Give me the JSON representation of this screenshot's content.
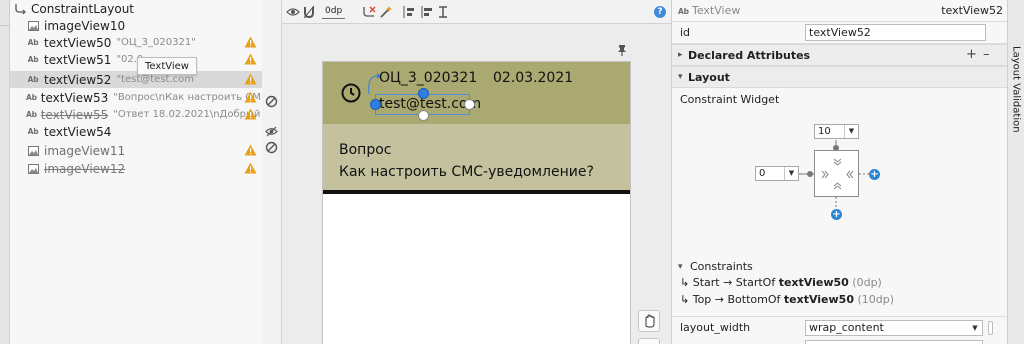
{
  "component_tree": {
    "root": {
      "label": "ConstraintLayout",
      "icon": "constraint-layout-icon"
    },
    "items": [
      {
        "name": "imageView10",
        "attr": "",
        "type": "image",
        "warning": false,
        "strike": false
      },
      {
        "name": "textView50",
        "attr": "\"ОЦ_3_020321\"",
        "type": "text",
        "warning": true,
        "strike": false
      },
      {
        "name": "textView51",
        "attr": "\"02.0",
        "type": "text",
        "warning": true,
        "strike": false
      },
      {
        "name": "textView52",
        "attr": "\"test@test.com",
        "type": "text",
        "warning": true,
        "strike": false,
        "selected": true
      },
      {
        "name": "textView53",
        "attr": "\"Вопрос\\nКак настроить СМ...",
        "type": "text",
        "warning": true,
        "strike": false
      },
      {
        "name": "textView55",
        "attr": "\"Ответ 18.02.2021\\nДобрый ...",
        "type": "text",
        "warning": true,
        "strike": true
      },
      {
        "name": "textView54",
        "attr": "",
        "type": "text",
        "warning": false,
        "strike": false
      },
      {
        "name": "imageView11",
        "attr": "",
        "type": "image",
        "warning": true,
        "strike": false
      },
      {
        "name": "imageView12",
        "attr": "",
        "type": "image",
        "warning": true,
        "strike": true
      }
    ],
    "tooltip": "TextView"
  },
  "canvas_toolbar": {
    "dp_value": "0dp",
    "icons": [
      "eye-icon",
      "magnet-icon",
      "clear-constraints-icon",
      "magic-wand-icon",
      "pack-icon",
      "align-icon",
      "guidelines-icon"
    ]
  },
  "preview": {
    "code": "ОЦ_3_020321",
    "date": "02.03.2021",
    "email": "test@test.com",
    "question_label": "Вопрос",
    "question_text": "Как настроить СМС-уведомление?",
    "colors": {
      "header": "#aba972",
      "body": "#c4c29e",
      "accent": "#2f7fe0"
    }
  },
  "attributes": {
    "type_label": "TextView",
    "view_name": "textView52",
    "id_label": "id",
    "id_value": "textView52",
    "declared_section": "Declared Attributes",
    "layout_section": "Layout",
    "constraint_widget_title": "Constraint Widget",
    "top_margin": "10",
    "start_margin": "0",
    "constraints_title": "Constraints",
    "constraints": [
      {
        "prefix": "Start → StartOf ",
        "target": "textView50",
        "margin": "(0dp)"
      },
      {
        "prefix": "Top → BottomOf ",
        "target": "textView50",
        "margin": "(10dp)"
      }
    ],
    "layout_width_label": "layout_width",
    "layout_width_value": "wrap_content"
  },
  "right_strip": {
    "label": "Layout Validation"
  }
}
